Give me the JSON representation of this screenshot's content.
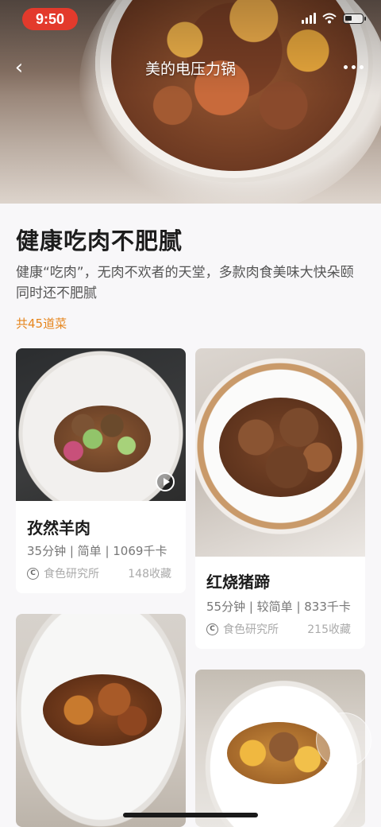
{
  "status_bar": {
    "time": "9:50"
  },
  "nav": {
    "back_icon": "chevron-left-icon",
    "title": "美的电压力锅",
    "more_icon": "more-icon"
  },
  "header": {
    "title": "健康吃肉不肥腻",
    "description": "健康“吃肉”，无肉不欢者的天堂，多款肉食美味大快朵颐同时还不肥腻",
    "count": "共45道菜"
  },
  "colors": {
    "accent": "#e6851c",
    "time_pill": "#e33a2c"
  },
  "recipes": [
    {
      "name": "孜然羊肉",
      "meta": "35分钟 | 简单 | 1069千卡",
      "author": "食色研究所",
      "saves": "148收藏",
      "has_video": true
    },
    {
      "name": "红烧猪蹄",
      "meta": "55分钟 | 较简单 | 833千卡",
      "author": "食色研究所",
      "saves": "215收藏",
      "has_video": false
    },
    {
      "name": "",
      "meta": "",
      "author": "",
      "saves": ""
    },
    {
      "name": "",
      "meta": "",
      "author": "",
      "saves": ""
    }
  ]
}
